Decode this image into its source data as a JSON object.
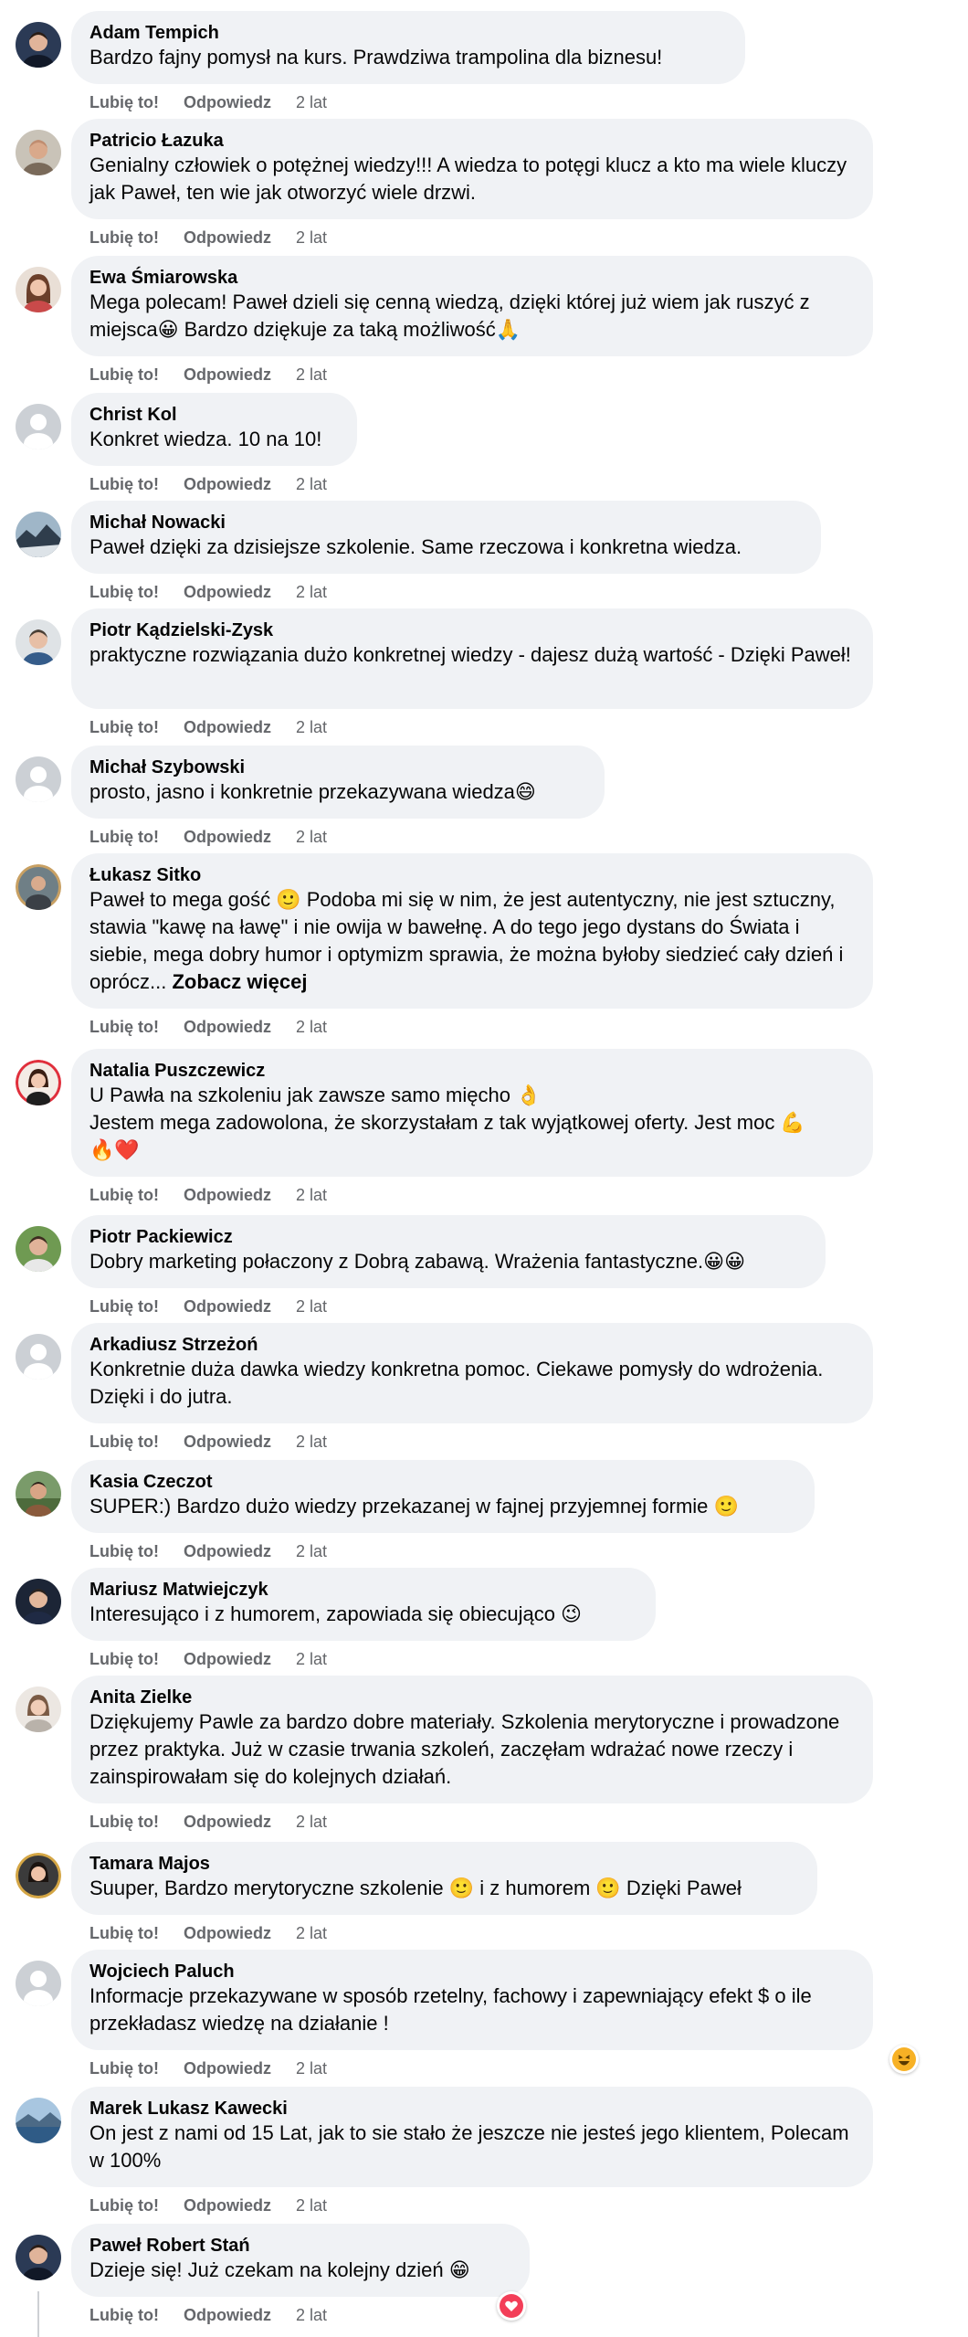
{
  "actions": {
    "like": "Lubię to!",
    "reply": "Odpowiedz"
  },
  "colors": {
    "bubble": "#f0f2f5",
    "meta": "#65676b",
    "heart": "#f33e58",
    "haha": "#f7b125"
  },
  "comments": [
    {
      "author": "Adam Tempich",
      "text": "Bardzo fajny pomysł na kurs. Prawdziwa trampolina dla biznesu!",
      "time": "2 lat",
      "avatar": "photo-man-dark"
    },
    {
      "author": "Patricio Łazuka",
      "text": "Genialny człowiek o potężnej wiedzy!!! A wiedza to potęgi klucz a kto ma wiele kluczy jak Paweł, ten wie jak otworzyć wiele drzwi.",
      "time": "2 lat",
      "avatar": "photo-man-bald"
    },
    {
      "author": "Ewa Śmiarowska",
      "text": "Mega polecam! Paweł dzieli się cenną wiedzą, dzięki której już wiem jak ruszyć z miejsca😀 Bardzo dziękuje za taką możliwość🙏",
      "time": "2 lat",
      "avatar": "photo-woman"
    },
    {
      "author": "Christ Kol",
      "text": "Konkret wiedza. 10 na 10!",
      "time": "2 lat",
      "avatar": "default-avatar"
    },
    {
      "author": "Michał Nowacki",
      "text": "Paweł dzięki za dzisiejsze szkolenie. Same rzeczowa i konkretna wiedza.",
      "time": "2 lat",
      "avatar": "photo-landscape"
    },
    {
      "author": "Piotr Kądzielski-Zysk",
      "text": "praktyczne rozwiązania dużo konkretnej wiedzy - dajesz dużą wartość - Dzięki Paweł!",
      "time": "2 lat",
      "avatar": "photo-man-light"
    },
    {
      "author": "Michał Szybowski",
      "text": "prosto, jasno i konkretnie przekazywana wiedza😄",
      "time": "2 lat",
      "avatar": "default-avatar"
    },
    {
      "author": "Łukasz Sitko",
      "text": "Paweł to mega gość 🙂 Podoba mi się w nim, że jest autentyczny, nie jest sztuczny, stawia \"kawę na ławę\" i nie owija w bawełnę. A do tego jego dystans do Świata i siebie, mega dobry humor i optymizm sprawia, że można byłoby siedzieć cały dzień i oprócz... ",
      "see_more": "Zobacz więcej",
      "time": "2 lat",
      "avatar": "photo-man-ring"
    },
    {
      "author": "Natalia Puszczewicz",
      "text": "U Pawła na szkoleniu jak zawsze samo mięcho 👌\nJestem mega zadowolona, że skorzystałam z tak wyjątkowej oferty. Jest moc 💪\n🔥❤️",
      "time": "2 lat",
      "avatar": "photo-woman-ring"
    },
    {
      "author": "Piotr Packiewicz",
      "text": "Dobry marketing połaczony z Dobrą zabawą. Wrażenia fantastyczne.😀😀",
      "time": "2 lat",
      "avatar": "photo-man-green"
    },
    {
      "author": "Arkadiusz Strzeżoń",
      "text": "Konkretnie duża dawka wiedzy konkretna pomoc. Ciekawe pomysły do wdrożenia. Dzięki i do jutra.",
      "time": "2 lat",
      "avatar": "default-avatar"
    },
    {
      "author": "Kasia Czeczot",
      "text": "SUPER:) Bardzo dużo wiedzy przekazanej w fajnej przyjemnej formie 🙂",
      "time": "2 lat",
      "avatar": "photo-outdoor"
    },
    {
      "author": "Mariusz Matwiejczyk",
      "text": "Interesująco i z humorem, zapowiada się obiecująco 😉",
      "time": "2 lat",
      "avatar": "photo-man-suit"
    },
    {
      "author": "Anita Zielke",
      "text": "Dziękujemy Pawle za bardzo dobre materiały. Szkolenia merytoryczne i prowadzone przez praktyka. Już w czasie trwania szkoleń, zaczęłam wdrażać nowe rzeczy i zainspirowałam się do kolejnych działań.",
      "time": "2 lat",
      "avatar": "photo-woman-light"
    },
    {
      "author": "Tamara Majos",
      "text": "Suuper, Bardzo merytoryczne szkolenie 🙂 i z humorem 🙂 Dzięki Paweł",
      "time": "2 lat",
      "avatar": "photo-woman-ring-gold"
    },
    {
      "author": "Wojciech Paluch",
      "text": "Informacje przekazywane w sposób rzetelny, fachowy i zapewniający efekt $ o ile przekładasz wiedzę na działanie !",
      "time": "2 lat",
      "avatar": "default-avatar",
      "reaction": "haha-icon"
    },
    {
      "author": "Marek Lukasz Kawecki",
      "text": "On jest z nami od 15 Lat, jak to sie stało że jeszcze nie jesteś jego klientem, Polecam w 100%",
      "time": "2 lat",
      "avatar": "photo-lake"
    },
    {
      "author": "Paweł Robert Stań",
      "text": "Dzieje się! Już czekam na kolejny dzień 😁",
      "time": "2 lat",
      "avatar": "photo-man-dark",
      "reaction": "heart-icon"
    }
  ]
}
